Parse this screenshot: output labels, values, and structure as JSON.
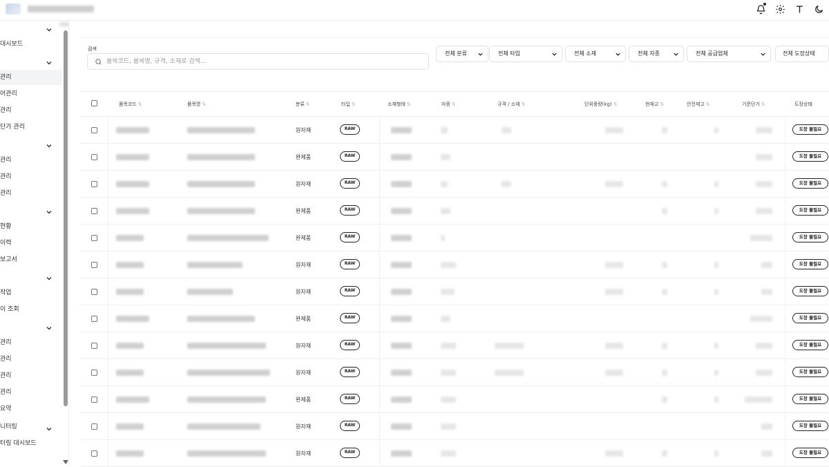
{
  "topbar": {
    "icons": [
      "bell-icon",
      "gear-icon",
      "text-size-icon",
      "dark-mode-icon"
    ]
  },
  "sidebar": {
    "rows": [
      {
        "label": "",
        "type": "group"
      },
      {
        "label": "대시보드",
        "type": "item"
      },
      {
        "label": "",
        "type": "group"
      },
      {
        "label": "관리",
        "type": "item",
        "active": true
      },
      {
        "label": "어관리",
        "type": "item"
      },
      {
        "label": "관리",
        "type": "item"
      },
      {
        "label": "단가 관리",
        "type": "item"
      },
      {
        "label": "",
        "type": "group"
      },
      {
        "label": "관리",
        "type": "item"
      },
      {
        "label": "관리",
        "type": "item"
      },
      {
        "label": "관리",
        "type": "item"
      },
      {
        "label": "",
        "type": "group"
      },
      {
        "label": "현황",
        "type": "item"
      },
      {
        "label": "이력",
        "type": "item"
      },
      {
        "label": "보고서",
        "type": "item"
      },
      {
        "label": "",
        "type": "group"
      },
      {
        "label": "작업",
        "type": "item"
      },
      {
        "label": "이 조회",
        "type": "item"
      },
      {
        "label": "",
        "type": "group"
      },
      {
        "label": "관리",
        "type": "item"
      },
      {
        "label": "관리",
        "type": "item"
      },
      {
        "label": "관리",
        "type": "item"
      },
      {
        "label": "관리",
        "type": "item"
      },
      {
        "label": "요약",
        "type": "item"
      },
      {
        "label": "니터링",
        "type": "group"
      },
      {
        "label": "터링 대시보드",
        "type": "item"
      }
    ]
  },
  "filters": {
    "search_label": "검색",
    "search_placeholder": "품목코드, 품목명, 규격, 소재로 검색...",
    "dropdowns": [
      "전체 분류",
      "전체 타입",
      "전체 소재",
      "전체 자종",
      "전체 공급업체",
      "전체 도장상태"
    ]
  },
  "table": {
    "headers": [
      "품목코드",
      "품목명",
      "분류",
      "타입",
      "소재형태",
      "자종",
      "규격 / 소재",
      "단위중량(kg)",
      "현재고",
      "안전재고",
      "기준단가",
      "도장상태"
    ],
    "sort_glyph": "⇅",
    "rows": [
      {
        "category": "원자재",
        "type": "RAW",
        "paint": "도장 불필요"
      },
      {
        "category": "완제품",
        "type": "RAW",
        "paint": "도장 불필요"
      },
      {
        "category": "원자재",
        "type": "RAW",
        "paint": "도장 불필요"
      },
      {
        "category": "완제품",
        "type": "RAW",
        "paint": "도장 불필요"
      },
      {
        "category": "완제품",
        "type": "RAW",
        "paint": "도장 불필요"
      },
      {
        "category": "원자재",
        "type": "RAW",
        "paint": "도장 불필요"
      },
      {
        "category": "원자재",
        "type": "RAW",
        "paint": "도장 불필요"
      },
      {
        "category": "완제품",
        "type": "RAW",
        "paint": "도장 불필요"
      },
      {
        "category": "원자재",
        "type": "RAW",
        "paint": "도장 불필요"
      },
      {
        "category": "원자재",
        "type": "RAW",
        "paint": "도장 불필요"
      },
      {
        "category": "완제품",
        "type": "RAW",
        "paint": "도장 불필요"
      },
      {
        "category": "원자재",
        "type": "RAW",
        "paint": "도장 불필요"
      },
      {
        "category": "원자재",
        "type": "RAW",
        "paint": "도장 불필요"
      }
    ]
  }
}
